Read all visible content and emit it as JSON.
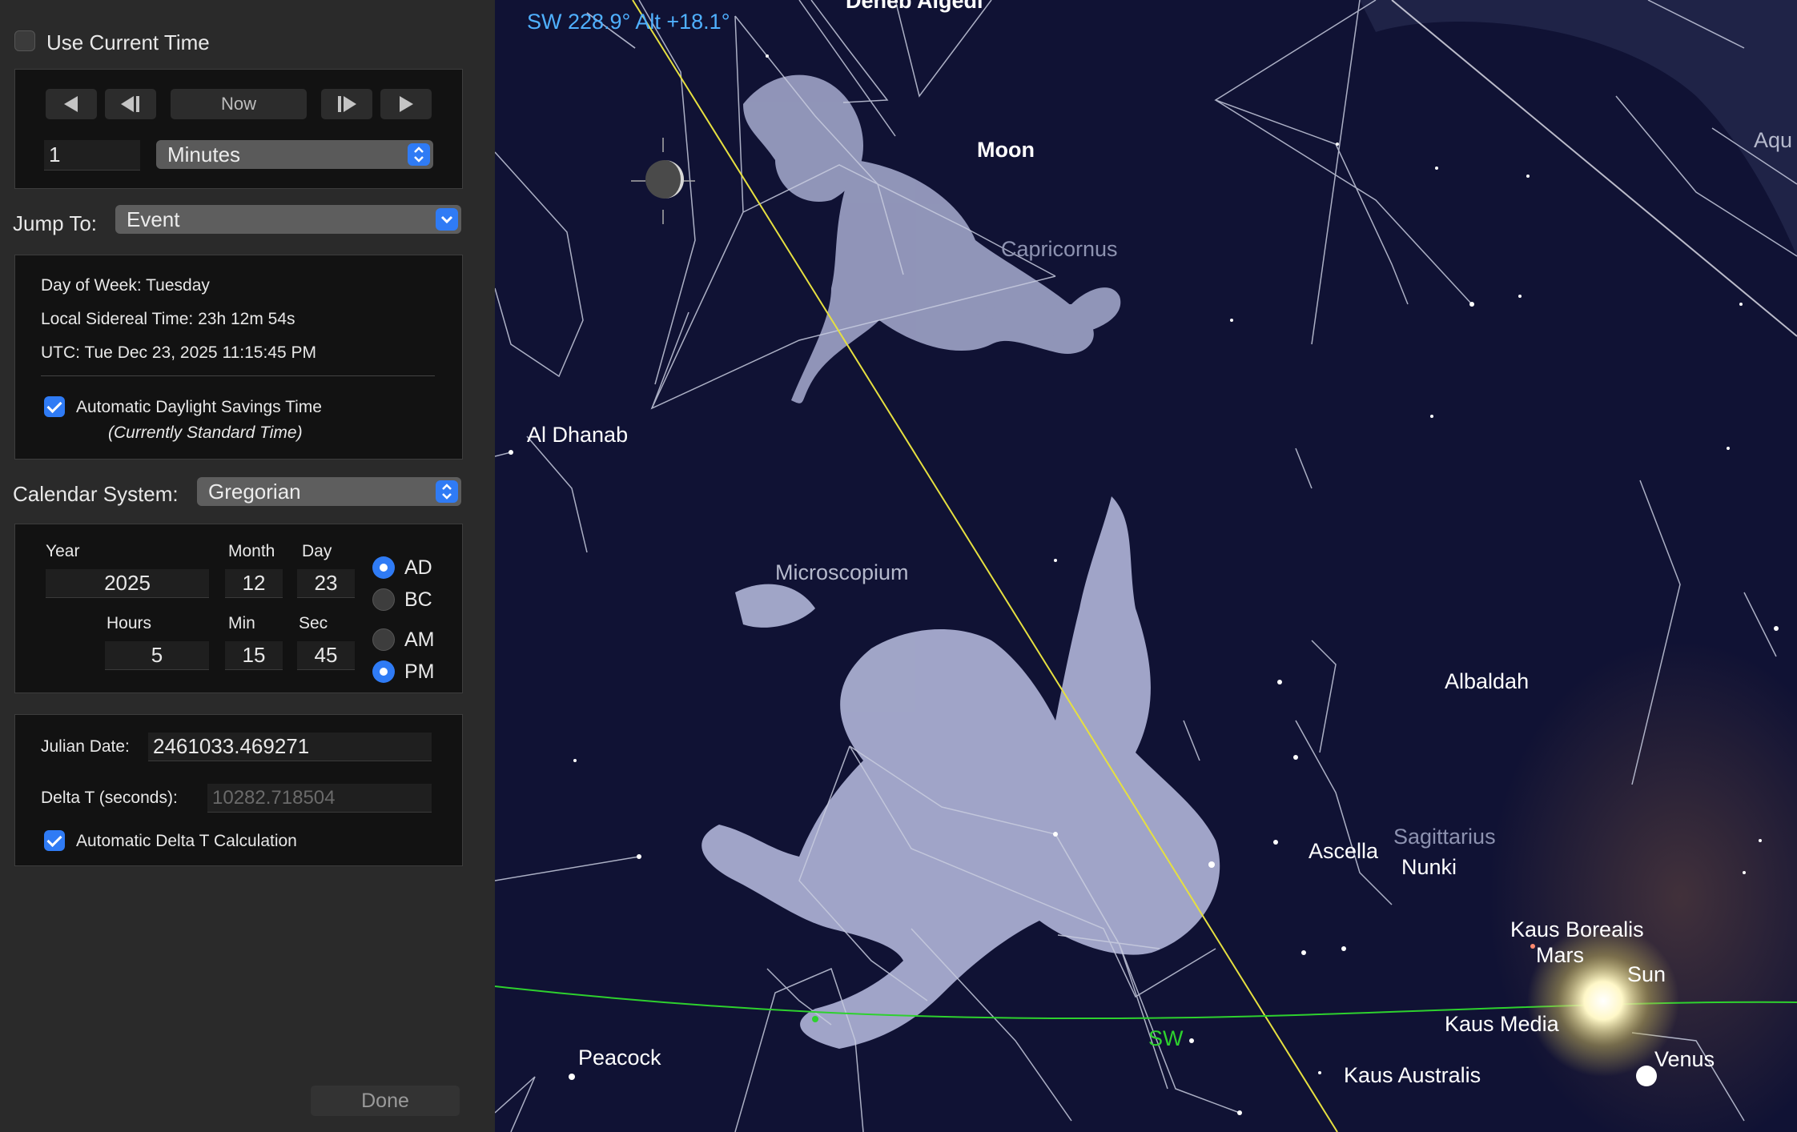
{
  "panel": {
    "use_current_time": {
      "label": "Use Current Time",
      "checked": false
    },
    "step_controls": {
      "now_label": "Now",
      "amount": "1",
      "unit": "Minutes"
    },
    "jump_to": {
      "label": "Jump To:",
      "value": "Event"
    },
    "info": {
      "day_of_week": "Day of Week:  Tuesday",
      "sidereal": "Local Sidereal Time:  23h 12m 54s",
      "utc": "UTC:  Tue Dec 23, 2025  11:15:45 PM",
      "dst_label": "Automatic Daylight Savings Time",
      "dst_checked": true,
      "dst_status": "(Currently Standard Time)"
    },
    "calendar": {
      "label": "Calendar System:",
      "value": "Gregorian"
    },
    "date": {
      "year_label": "Year",
      "year": "2025",
      "month_label": "Month",
      "month": "12",
      "day_label": "Day",
      "day": "23",
      "hours_label": "Hours",
      "hours": "5",
      "min_label": "Min",
      "min": "15",
      "sec_label": "Sec",
      "sec": "45",
      "ad_label": "AD",
      "bc_label": "BC",
      "era_selected": "AD",
      "am_label": "AM",
      "pm_label": "PM",
      "ampm_selected": "PM"
    },
    "julian": {
      "label": "Julian Date:",
      "value": "2461033.469271",
      "delta_label": "Delta T (seconds):",
      "delta_value": "10282.718504",
      "auto_delta_label": "Automatic Delta T Calculation",
      "auto_delta_checked": true
    },
    "done_label": "Done"
  },
  "sky": {
    "readout": "SW 228.9° Alt +18.1°",
    "labels": {
      "deneb_algedi": "Deneb Algedi",
      "moon": "Moon",
      "capricornus": "Capricornus",
      "aquarius": "Aqu",
      "al_dhanab": "Al Dhanab",
      "microscopium": "Microscopium",
      "albaldah": "Albaldah",
      "ascella": "Ascella",
      "sagittarius": "Sagittarius",
      "nunki": "Nunki",
      "kaus_borealis": "Kaus Borealis",
      "mars": "Mars",
      "sun": "Sun",
      "kaus_media": "Kaus Media",
      "sw": "SW",
      "venus": "Venus",
      "kaus_australis": "Kaus Australis",
      "peacock": "Peacock"
    },
    "colors": {
      "background": "#0e1030",
      "ecliptic": "#e6e040",
      "horizon": "#2ed12e",
      "readout": "#4fb0ff",
      "constellation_line": "#c8ccdf",
      "figure": "#a7acd0"
    }
  }
}
